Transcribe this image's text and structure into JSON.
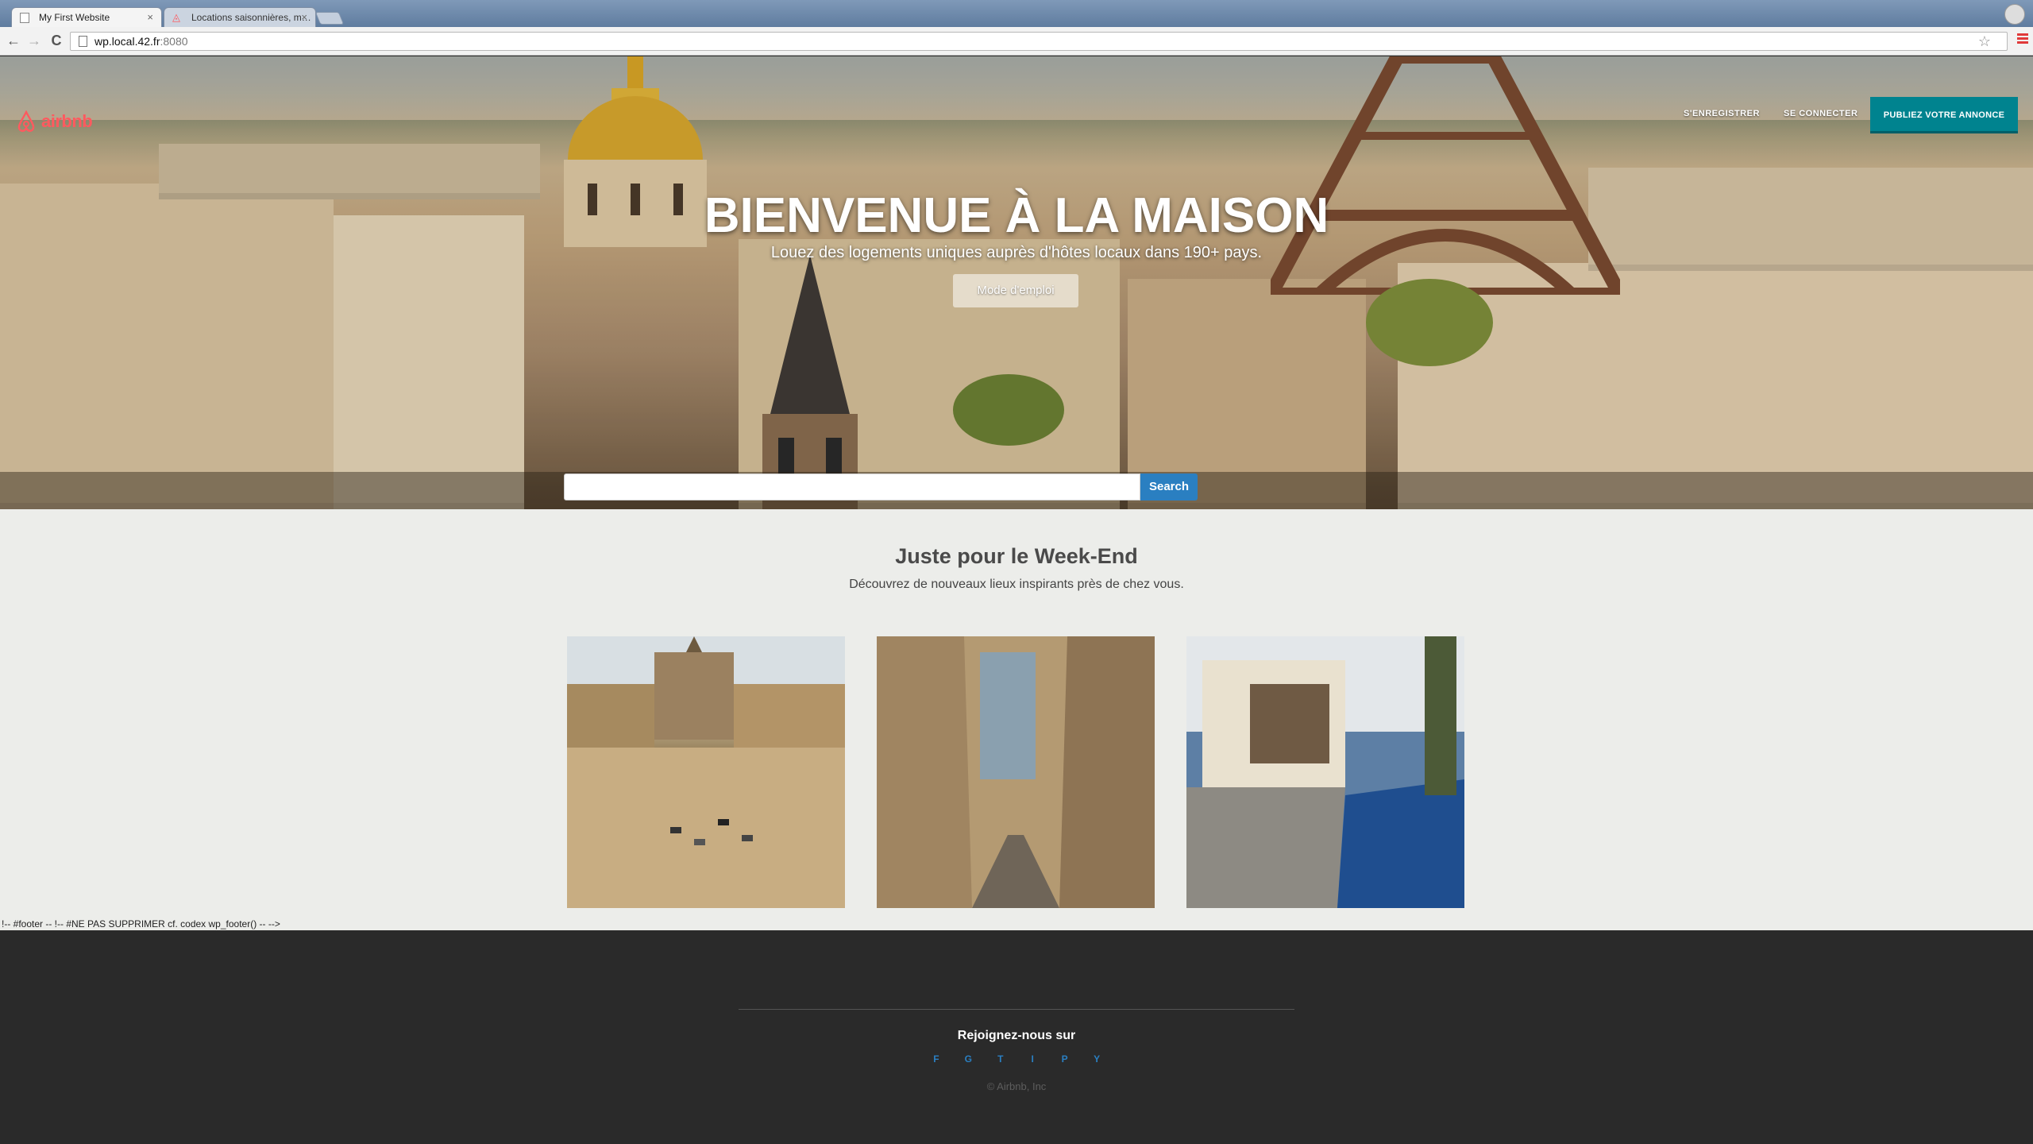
{
  "browser": {
    "tabs": [
      {
        "title": "My First Website",
        "close": "×"
      },
      {
        "title": "Locations saisonnières, m…",
        "close": "×"
      }
    ],
    "url_host": "wp.local.42.fr",
    "url_port": ":8080",
    "back": "←",
    "forward": "→",
    "reload": "C",
    "star": "☆"
  },
  "header": {
    "logo": "airbnb",
    "register": "S'ENREGISTRER",
    "login": "SE CONNECTER",
    "publish": "PUBLIEZ VOTRE ANNONCE"
  },
  "hero": {
    "title": "BIENVENUE À LA MAISON",
    "subtitle": "Louez des logements uniques auprès d'hôtes locaux dans 190+ pays.",
    "howto_button": "Mode d'emploi",
    "search_value": "",
    "search_button": "Search"
  },
  "weekend": {
    "title": "Juste pour le Week-End",
    "subtitle": "Découvrez de nouveaux lieux inspirants près de chez vous."
  },
  "debug_comment": "!-- #footer -- !-- #NE PAS SUPPRIMER cf. codex wp_footer() -- -->",
  "footer": {
    "title": "Rejoignez-nous sur",
    "social": [
      "F",
      "G",
      "T",
      "I",
      "P",
      "Y"
    ],
    "copyright": "© Airbnb, Inc"
  },
  "colors": {
    "brand": "#ff5a5f",
    "publish_button": "#00838f",
    "search_button": "#2a7fc1",
    "footer_bg": "#2a2a2a",
    "content_bg": "#ecedea"
  }
}
